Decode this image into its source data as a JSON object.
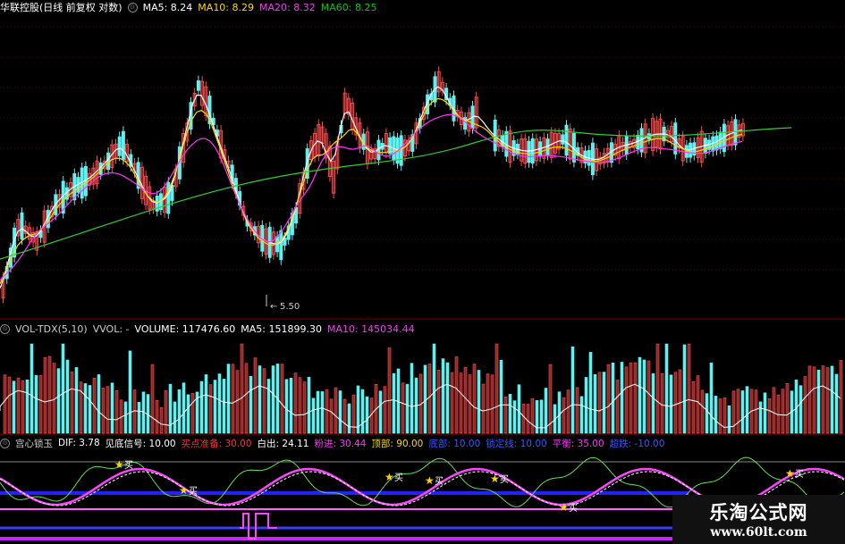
{
  "price_panel": {
    "title": "华联控股(日线 前复权 对数)",
    "ma5_label": "MA5: 8.24",
    "ma10_label": "MA10: 8.29",
    "ma20_label": "MA20: 8.32",
    "ma60_label": "MA60: 8.25",
    "low_mark": "5.50",
    "colors": {
      "ma5": "#ffffff",
      "ma10": "#ffd700",
      "ma20": "#ff33ff",
      "ma60": "#00cc00"
    }
  },
  "volume_panel": {
    "title": "VOL-TDX(5,10)",
    "vvol_label": "VVOL: -",
    "volume_label": "VOLUME: 117476.60",
    "ma5_label": "MA5: 151899.30",
    "ma10_label": "MA10: 145034.44"
  },
  "indicator_panel": {
    "title": "宫心锁玉",
    "dif": "DIF: 3.78",
    "see_bottom": "见底信号: 10.00",
    "buy_prep": "买点准备: 30.00",
    "white_out": "白出: 24.11",
    "pink_in": "粉进: 30.44",
    "top": "顶部: 90.00",
    "bottom": "底部: 10.00",
    "lock_line": "锁定线: 10.00",
    "balance": "平衡: 35.00",
    "oversold": "超跌: -10.00",
    "buy_marker": "买"
  },
  "watermark": {
    "line1": "乐淘公式网",
    "line2": "www.60lt.com"
  }
}
